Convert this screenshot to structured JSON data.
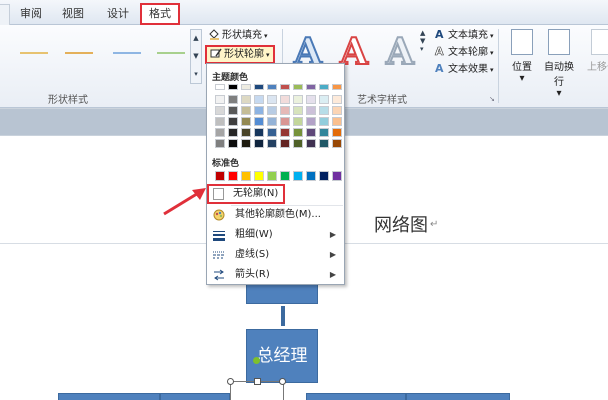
{
  "tabs": {
    "review": "审阅",
    "view": "视图",
    "design": "设计",
    "format": "格式"
  },
  "ribbon": {
    "shape_styles_label": "形状样式",
    "shape_fill": "形状填充",
    "shape_outline": "形状轮廓",
    "wordart_styles_label": "艺术字样式",
    "wordart_letter": "A",
    "text_fill": "文本填充",
    "text_outline": "文本轮廓",
    "text_effects": "文本效果",
    "position": "位置",
    "wrap_text": "自动换行",
    "bring_forward": "上移一",
    "line_styles": [
      "#e7c270",
      "#e4b05a",
      "#8fb6e3",
      "#a8d08d"
    ],
    "accent_red": "#e0303a"
  },
  "menu": {
    "theme_colors_label": "主题颜色",
    "theme_colors": [
      [
        "#ffffff",
        "#000000",
        "#eeece1",
        "#1f497d",
        "#4f81bd",
        "#c0504d",
        "#9bbb59",
        "#8064a2",
        "#4bacc6",
        "#f79646"
      ],
      [
        "#f2f2f2",
        "#7f7f7f",
        "#ddd9c3",
        "#c6d9f0",
        "#dbe5f1",
        "#f2dcdb",
        "#ebf1dd",
        "#e5e0ec",
        "#dbeef3",
        "#fdeada"
      ],
      [
        "#d8d8d8",
        "#595959",
        "#c4bd97",
        "#8db3e2",
        "#b8cce4",
        "#e5b9b7",
        "#d7e3bc",
        "#ccc1d9",
        "#b7dde8",
        "#fbd5b5"
      ],
      [
        "#bfbfbf",
        "#3f3f3f",
        "#938953",
        "#548dd4",
        "#95b3d7",
        "#d99694",
        "#c3d69b",
        "#b2a2c7",
        "#92cddc",
        "#fac08f"
      ],
      [
        "#a5a5a5",
        "#262626",
        "#494429",
        "#17365d",
        "#366092",
        "#953734",
        "#76923c",
        "#5f497a",
        "#31859b",
        "#e36c09"
      ],
      [
        "#7f7f7f",
        "#0c0c0c",
        "#1d1b10",
        "#0f243e",
        "#244061",
        "#632423",
        "#4f6128",
        "#3f3151",
        "#205867",
        "#974806"
      ]
    ],
    "standard_colors_label": "标准色",
    "standard_colors": [
      "#c00000",
      "#ff0000",
      "#ffc000",
      "#ffff00",
      "#92d050",
      "#00b050",
      "#00b0f0",
      "#0070c0",
      "#002060",
      "#7030a0"
    ],
    "no_outline": "无轮廓(N)",
    "more_outline_colors": "其他轮廓颜色(M)...",
    "weight": "粗细(W)",
    "dashes": "虚线(S)",
    "arrows": "箭头(R)"
  },
  "document": {
    "title": "网络图",
    "para_mark": "↵",
    "node_general_manager": "总经理",
    "node_color": "#4f81bd"
  }
}
